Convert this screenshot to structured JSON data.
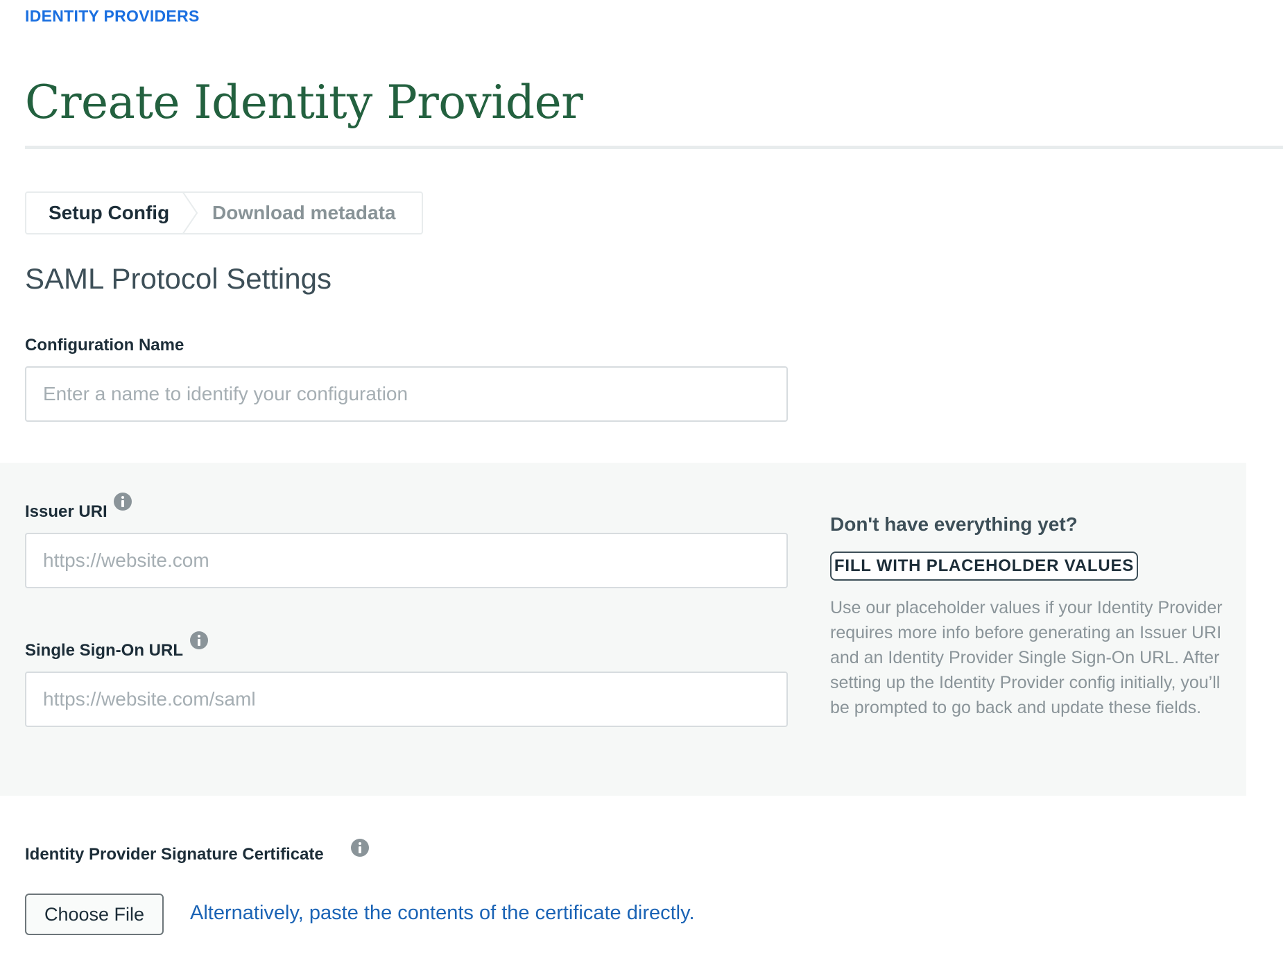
{
  "breadcrumb": {
    "label": "IDENTITY PROVIDERS"
  },
  "page": {
    "title": "Create Identity Provider"
  },
  "stepper": {
    "steps": [
      {
        "label": "Setup Config",
        "state": "active"
      },
      {
        "label": "Download metadata",
        "state": "inactive"
      }
    ]
  },
  "section": {
    "title": "SAML Protocol Settings"
  },
  "fields": {
    "config_name": {
      "label": "Configuration Name",
      "value": "",
      "placeholder": "Enter a name to identify your configuration"
    },
    "issuer_uri": {
      "label": "Issuer URI",
      "value": "",
      "placeholder": "https://website.com"
    },
    "sso_url": {
      "label": "Single Sign-On URL",
      "value": "",
      "placeholder": "https://website.com/saml"
    },
    "certificate": {
      "label": "Identity Provider Signature Certificate"
    }
  },
  "side_panel": {
    "title": "Don't have everything yet?",
    "button_label": "FILL WITH PLACEHOLDER VALUES",
    "description": "Use our placeholder values if your Identity Provider requires more info before generating an Issuer URI and an Identity Provider Single Sign-On URL. After setting up the Identity Provider config initially, you’ll be prompted to go back and update these fields."
  },
  "upload": {
    "choose_file_label": "Choose File",
    "paste_link": "Alternatively, paste the contents of the certificate directly."
  },
  "icons": {
    "info": "info-icon",
    "step_separator": "chevron-right-icon"
  },
  "colors": {
    "breadcrumb": "#1a6fe0",
    "title": "#23613f",
    "link": "#1a63b5",
    "panel_background": "#f6f8f7"
  }
}
